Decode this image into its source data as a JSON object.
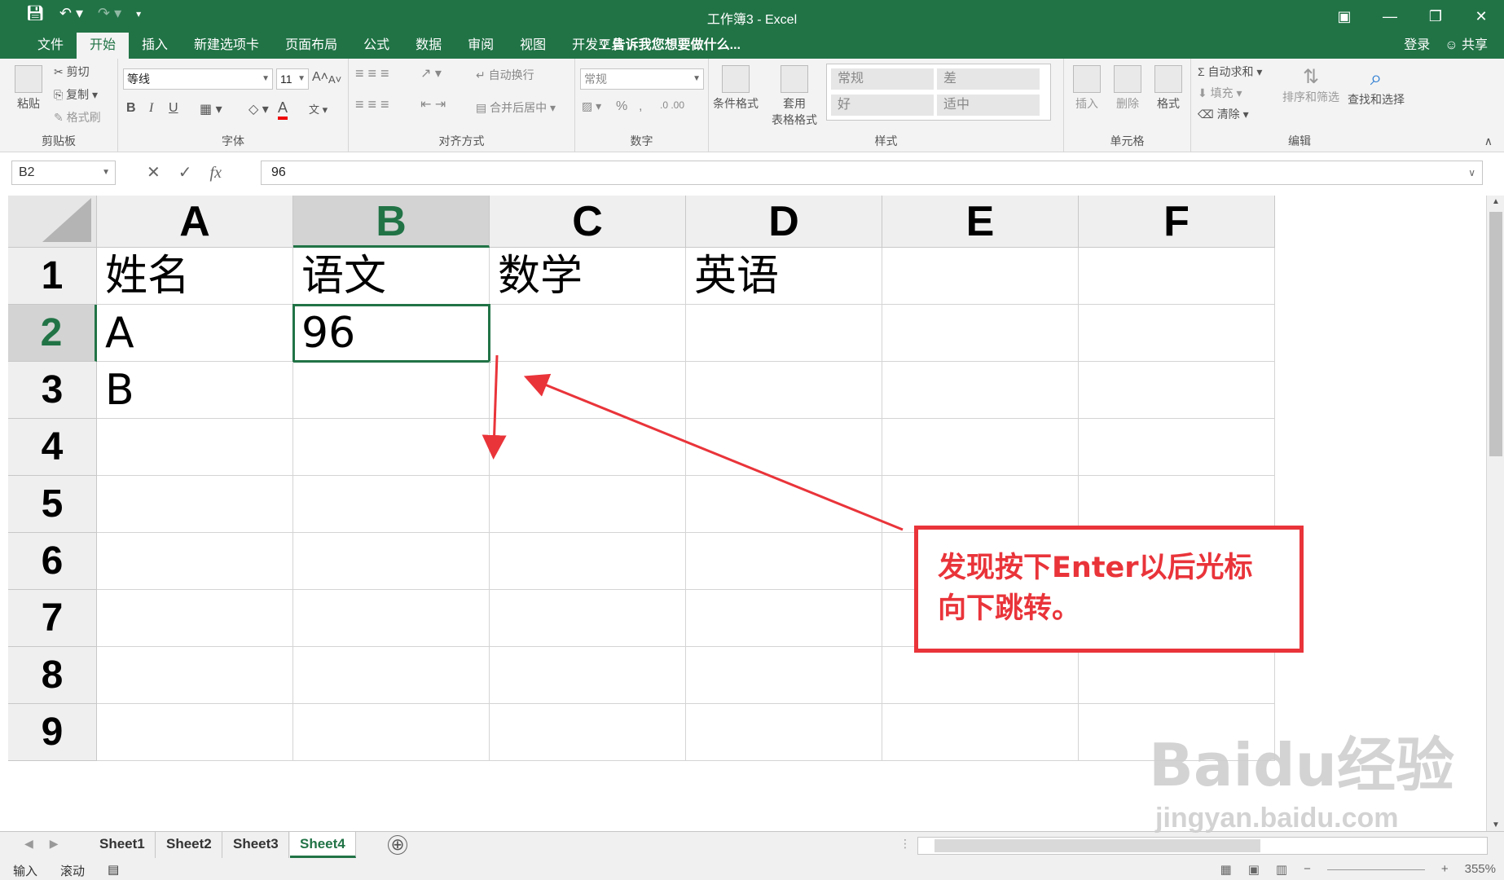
{
  "window": {
    "title": "工作簿3 - Excel"
  },
  "qat": {
    "save_icon": "save-icon",
    "undo_icon": "undo-icon",
    "redo_icon": "redo-icon",
    "customize_icon": "customize-icon"
  },
  "menu": {
    "tabs": [
      "文件",
      "开始",
      "插入",
      "新建选项卡",
      "页面布局",
      "公式",
      "数据",
      "审阅",
      "视图",
      "开发工具"
    ],
    "active_tab": "开始",
    "tell_me": "告诉我您想要做什么...",
    "login": "登录",
    "share": "共享"
  },
  "ribbon": {
    "clipboard": {
      "paste": "粘贴",
      "cut": "剪切",
      "copy": "复制",
      "format_painter": "格式刷",
      "label": "剪贴板"
    },
    "font": {
      "family": "等线",
      "size": "11",
      "bold": "B",
      "italic": "I",
      "underline": "U",
      "grow": "A",
      "shrink": "A",
      "color": "A",
      "label": "字体"
    },
    "alignment": {
      "wrap_text": "自动换行",
      "merge_center": "合并后居中",
      "label": "对齐方式"
    },
    "number": {
      "format": "常规",
      "percent": "%",
      "comma": ",",
      "label": "数字"
    },
    "styles": {
      "conditional": "条件格式",
      "table_format_1": "套用",
      "table_format_2": "表格格式",
      "cells": [
        "常规",
        "差",
        "好",
        "适中"
      ],
      "label": "样式"
    },
    "cells_group": {
      "insert": "插入",
      "delete": "删除",
      "format": "格式",
      "label": "单元格"
    },
    "editing": {
      "autosum": "自动求和",
      "fill": "填充",
      "clear": "清除",
      "sort_filter": "排序和筛选",
      "find_select": "查找和选择",
      "label": "编辑"
    }
  },
  "formula_bar": {
    "name_box": "B2",
    "cancel": "✕",
    "enter": "✓",
    "fx": "fx",
    "content": "96"
  },
  "grid": {
    "columns": [
      "A",
      "B",
      "C",
      "D",
      "E",
      "F"
    ],
    "rows": [
      "1",
      "2",
      "3",
      "4",
      "5",
      "6",
      "7",
      "8",
      "9"
    ],
    "cells": [
      [
        "姓名",
        "语文",
        "数学",
        "英语",
        "",
        ""
      ],
      [
        "A",
        "96",
        "",
        "",
        "",
        ""
      ],
      [
        "B",
        "",
        "",
        "",
        "",
        ""
      ],
      [
        "",
        "",
        "",
        "",
        "",
        ""
      ],
      [
        "",
        "",
        "",
        "",
        "",
        ""
      ],
      [
        "",
        "",
        "",
        "",
        "",
        ""
      ],
      [
        "",
        "",
        "",
        "",
        "",
        ""
      ],
      [
        "",
        "",
        "",
        "",
        "",
        ""
      ],
      [
        "",
        "",
        "",
        "",
        "",
        ""
      ]
    ],
    "active_cell": "B2"
  },
  "sheets": {
    "tabs": [
      "Sheet1",
      "Sheet2",
      "Sheet3",
      "Sheet4"
    ],
    "active": "Sheet4",
    "add": "⊕"
  },
  "status": {
    "mode": "输入",
    "scroll": "滚动",
    "zoom": "355%"
  },
  "annotation": {
    "text_line1": "发现按下Enter以后光标",
    "text_line2": "向下跳转。",
    "color": "#e9343a"
  },
  "watermark": {
    "main": "Baidu经验",
    "sub": "jingyan.baidu.com"
  },
  "colors": {
    "excel_green": "#217346",
    "annotation_red": "#e9343a"
  }
}
